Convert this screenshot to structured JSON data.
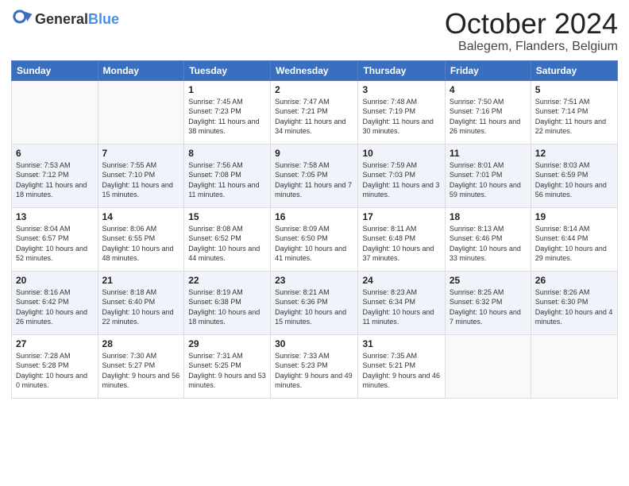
{
  "header": {
    "logo_general": "General",
    "logo_blue": "Blue",
    "month": "October 2024",
    "location": "Balegem, Flanders, Belgium"
  },
  "days_of_week": [
    "Sunday",
    "Monday",
    "Tuesday",
    "Wednesday",
    "Thursday",
    "Friday",
    "Saturday"
  ],
  "weeks": [
    [
      {
        "day": "",
        "info": ""
      },
      {
        "day": "",
        "info": ""
      },
      {
        "day": "1",
        "info": "Sunrise: 7:45 AM\nSunset: 7:23 PM\nDaylight: 11 hours and 38 minutes."
      },
      {
        "day": "2",
        "info": "Sunrise: 7:47 AM\nSunset: 7:21 PM\nDaylight: 11 hours and 34 minutes."
      },
      {
        "day": "3",
        "info": "Sunrise: 7:48 AM\nSunset: 7:19 PM\nDaylight: 11 hours and 30 minutes."
      },
      {
        "day": "4",
        "info": "Sunrise: 7:50 AM\nSunset: 7:16 PM\nDaylight: 11 hours and 26 minutes."
      },
      {
        "day": "5",
        "info": "Sunrise: 7:51 AM\nSunset: 7:14 PM\nDaylight: 11 hours and 22 minutes."
      }
    ],
    [
      {
        "day": "6",
        "info": "Sunrise: 7:53 AM\nSunset: 7:12 PM\nDaylight: 11 hours and 18 minutes."
      },
      {
        "day": "7",
        "info": "Sunrise: 7:55 AM\nSunset: 7:10 PM\nDaylight: 11 hours and 15 minutes."
      },
      {
        "day": "8",
        "info": "Sunrise: 7:56 AM\nSunset: 7:08 PM\nDaylight: 11 hours and 11 minutes."
      },
      {
        "day": "9",
        "info": "Sunrise: 7:58 AM\nSunset: 7:05 PM\nDaylight: 11 hours and 7 minutes."
      },
      {
        "day": "10",
        "info": "Sunrise: 7:59 AM\nSunset: 7:03 PM\nDaylight: 11 hours and 3 minutes."
      },
      {
        "day": "11",
        "info": "Sunrise: 8:01 AM\nSunset: 7:01 PM\nDaylight: 10 hours and 59 minutes."
      },
      {
        "day": "12",
        "info": "Sunrise: 8:03 AM\nSunset: 6:59 PM\nDaylight: 10 hours and 56 minutes."
      }
    ],
    [
      {
        "day": "13",
        "info": "Sunrise: 8:04 AM\nSunset: 6:57 PM\nDaylight: 10 hours and 52 minutes."
      },
      {
        "day": "14",
        "info": "Sunrise: 8:06 AM\nSunset: 6:55 PM\nDaylight: 10 hours and 48 minutes."
      },
      {
        "day": "15",
        "info": "Sunrise: 8:08 AM\nSunset: 6:52 PM\nDaylight: 10 hours and 44 minutes."
      },
      {
        "day": "16",
        "info": "Sunrise: 8:09 AM\nSunset: 6:50 PM\nDaylight: 10 hours and 41 minutes."
      },
      {
        "day": "17",
        "info": "Sunrise: 8:11 AM\nSunset: 6:48 PM\nDaylight: 10 hours and 37 minutes."
      },
      {
        "day": "18",
        "info": "Sunrise: 8:13 AM\nSunset: 6:46 PM\nDaylight: 10 hours and 33 minutes."
      },
      {
        "day": "19",
        "info": "Sunrise: 8:14 AM\nSunset: 6:44 PM\nDaylight: 10 hours and 29 minutes."
      }
    ],
    [
      {
        "day": "20",
        "info": "Sunrise: 8:16 AM\nSunset: 6:42 PM\nDaylight: 10 hours and 26 minutes."
      },
      {
        "day": "21",
        "info": "Sunrise: 8:18 AM\nSunset: 6:40 PM\nDaylight: 10 hours and 22 minutes."
      },
      {
        "day": "22",
        "info": "Sunrise: 8:19 AM\nSunset: 6:38 PM\nDaylight: 10 hours and 18 minutes."
      },
      {
        "day": "23",
        "info": "Sunrise: 8:21 AM\nSunset: 6:36 PM\nDaylight: 10 hours and 15 minutes."
      },
      {
        "day": "24",
        "info": "Sunrise: 8:23 AM\nSunset: 6:34 PM\nDaylight: 10 hours and 11 minutes."
      },
      {
        "day": "25",
        "info": "Sunrise: 8:25 AM\nSunset: 6:32 PM\nDaylight: 10 hours and 7 minutes."
      },
      {
        "day": "26",
        "info": "Sunrise: 8:26 AM\nSunset: 6:30 PM\nDaylight: 10 hours and 4 minutes."
      }
    ],
    [
      {
        "day": "27",
        "info": "Sunrise: 7:28 AM\nSunset: 5:28 PM\nDaylight: 10 hours and 0 minutes."
      },
      {
        "day": "28",
        "info": "Sunrise: 7:30 AM\nSunset: 5:27 PM\nDaylight: 9 hours and 56 minutes."
      },
      {
        "day": "29",
        "info": "Sunrise: 7:31 AM\nSunset: 5:25 PM\nDaylight: 9 hours and 53 minutes."
      },
      {
        "day": "30",
        "info": "Sunrise: 7:33 AM\nSunset: 5:23 PM\nDaylight: 9 hours and 49 minutes."
      },
      {
        "day": "31",
        "info": "Sunrise: 7:35 AM\nSunset: 5:21 PM\nDaylight: 9 hours and 46 minutes."
      },
      {
        "day": "",
        "info": ""
      },
      {
        "day": "",
        "info": ""
      }
    ]
  ]
}
